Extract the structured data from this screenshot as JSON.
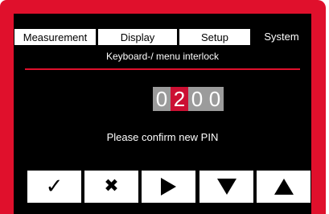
{
  "tabs": [
    {
      "label": "Measurement",
      "state": "inactive"
    },
    {
      "label": "Display",
      "state": "inactive"
    },
    {
      "label": "Setup",
      "state": "inactive"
    },
    {
      "label": "System",
      "state": "active"
    }
  ],
  "subtitle": "Keyboard-/ menu interlock",
  "pin": {
    "digits": [
      "0",
      "2",
      "0",
      "0"
    ],
    "active_index": 1
  },
  "prompt": "Please confirm new PIN",
  "softkeys": [
    {
      "icon": "checkmark-icon",
      "glyph": "✓"
    },
    {
      "icon": "cross-icon",
      "glyph": "✖"
    },
    {
      "icon": "right-arrow-icon"
    },
    {
      "icon": "down-arrow-icon"
    },
    {
      "icon": "up-arrow-icon"
    }
  ],
  "colors": {
    "bezel": "#e0102c",
    "screen": "#000000",
    "digit_inactive": "#9b9b9b",
    "digit_active": "#cc1033"
  }
}
